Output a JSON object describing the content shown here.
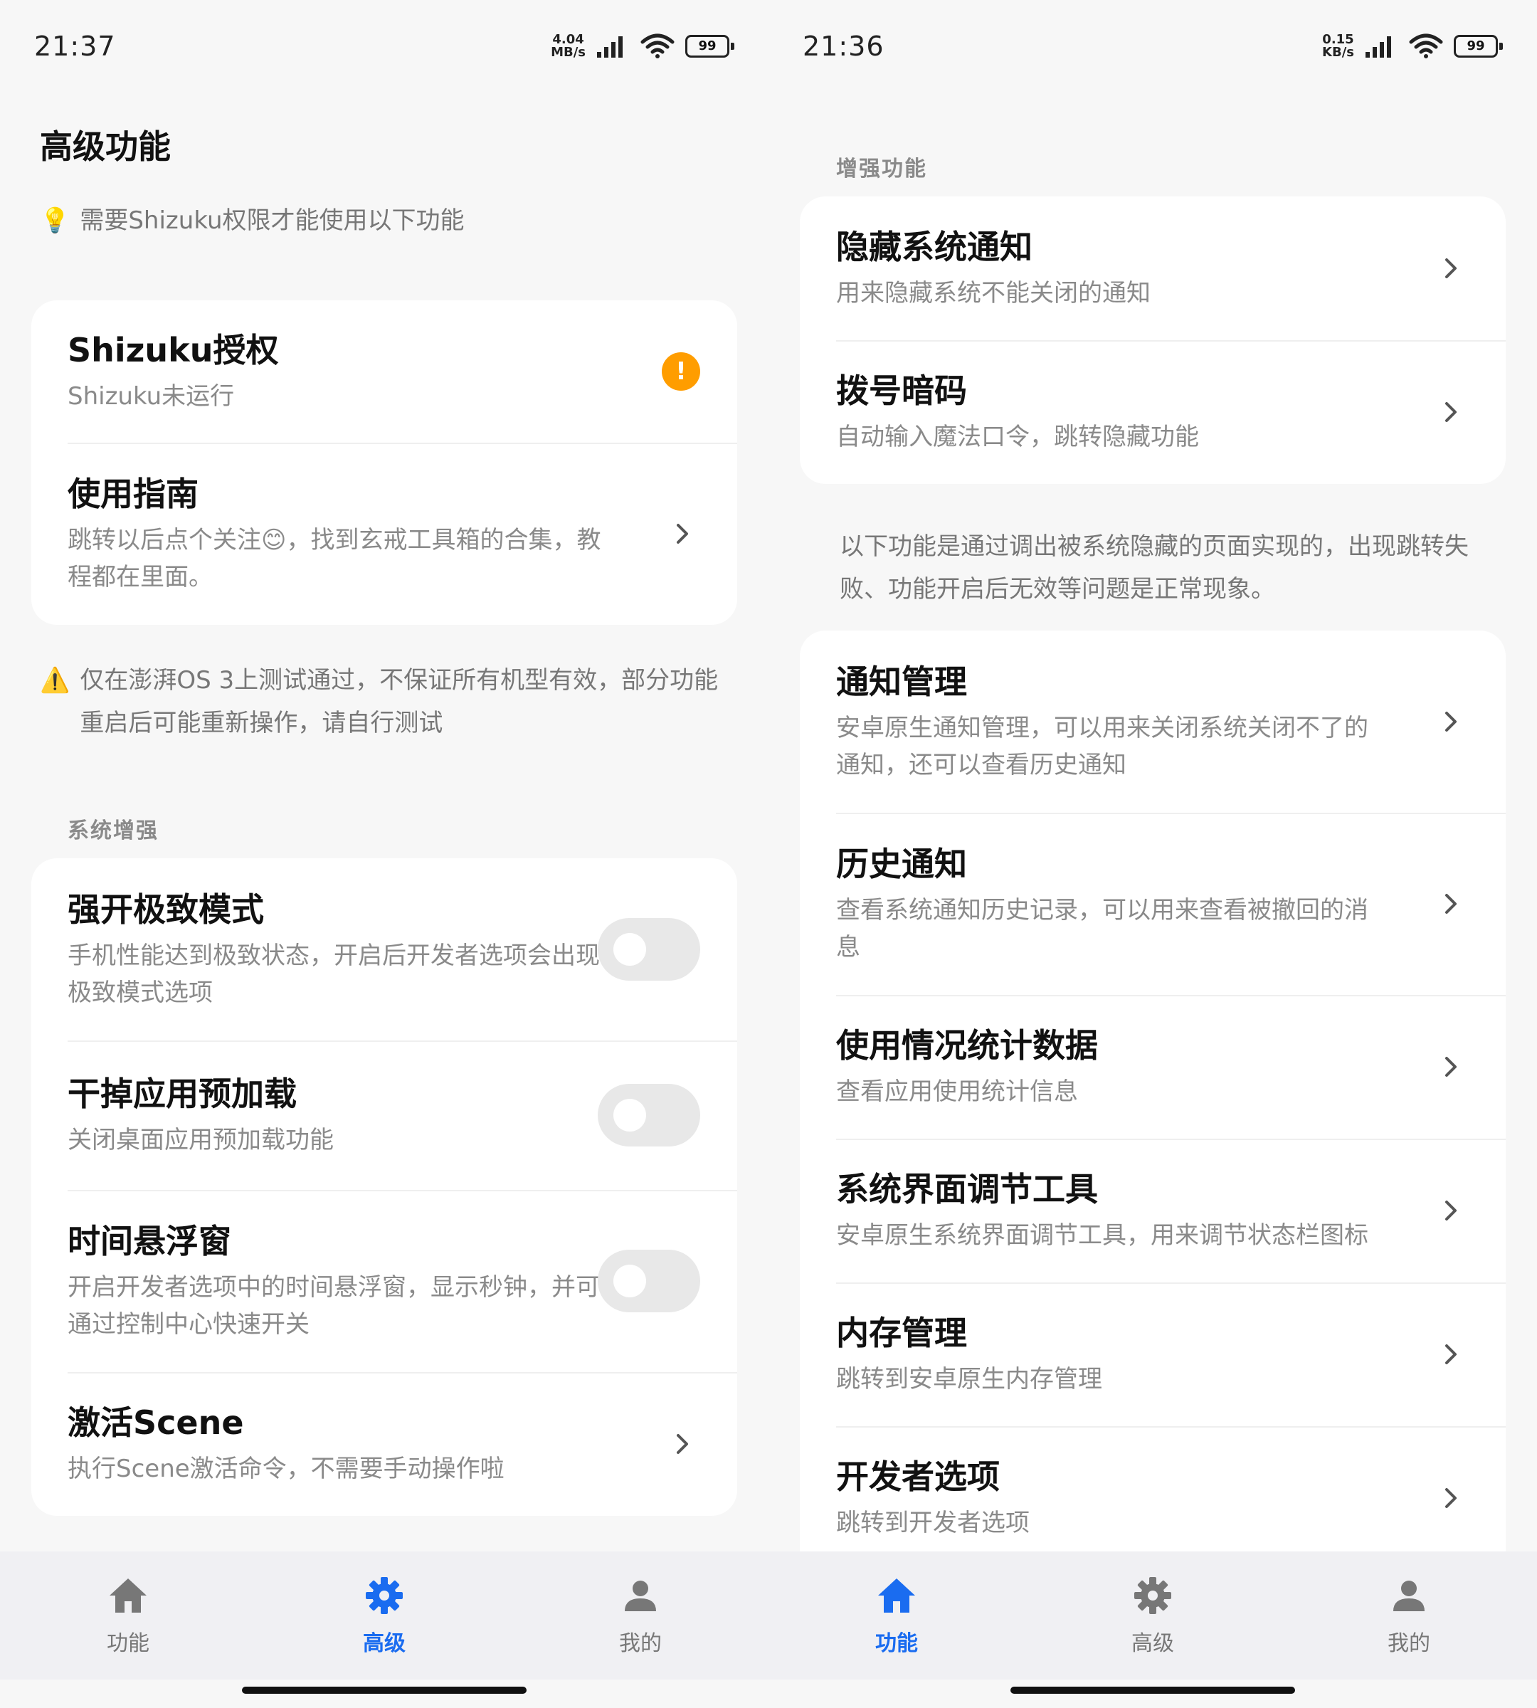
{
  "colors": {
    "accent": "#1a6cf0",
    "warning": "#ff9d00",
    "inactive_icon": "#777777"
  },
  "left": {
    "status": {
      "time": "21:37",
      "speed_value": "4.04",
      "speed_unit": "MB/s",
      "battery": "99"
    },
    "page_title": "高级功能",
    "hint": {
      "icon": "lightbulb-icon",
      "emoji": "💡",
      "text": "需要Shizuku权限才能使用以下功能"
    },
    "auth_card": {
      "shizuku": {
        "title": "Shizuku授权",
        "subtitle": "Shizuku未运行",
        "badge": "!"
      },
      "guide": {
        "title": "使用指南",
        "subtitle": "跳转以后点个关注😊，找到玄戒工具箱的合集，教程都在里面。"
      }
    },
    "warning": {
      "icon": "warning-icon",
      "emoji": "⚠️",
      "text": "仅在澎湃OS 3上测试通过，不保证所有机型有效，部分功能重启后可能重新操作，请自行测试"
    },
    "section_label": "系统增强",
    "system_items": [
      {
        "title": "强开极致模式",
        "subtitle": "手机性能达到极致状态，开启后开发者选项会出现极致模式选项",
        "control": "toggle",
        "on": false
      },
      {
        "title": "干掉应用预加载",
        "subtitle": "关闭桌面应用预加载功能",
        "control": "toggle",
        "on": false
      },
      {
        "title": "时间悬浮窗",
        "subtitle": "开启开发者选项中的时间悬浮窗，显示秒钟，并可通过控制中心快速开关",
        "control": "toggle",
        "on": false
      },
      {
        "title": "激活Scene",
        "subtitle": "执行Scene激活命令，不需要手动操作啦",
        "control": "chevron"
      }
    ],
    "nav": [
      {
        "label": "功能",
        "icon": "home-icon",
        "active": false
      },
      {
        "label": "高级",
        "icon": "gear-icon",
        "active": true
      },
      {
        "label": "我的",
        "icon": "person-icon",
        "active": false
      }
    ]
  },
  "right": {
    "status": {
      "time": "21:36",
      "speed_value": "0.15",
      "speed_unit": "KB/s",
      "battery": "99"
    },
    "section_label": "增强功能",
    "enhance_items": [
      {
        "title": "隐藏系统通知",
        "subtitle": "用来隐藏系统不能关闭的通知"
      },
      {
        "title": "拨号暗码",
        "subtitle": "自动输入魔法口令，跳转隐藏功能"
      }
    ],
    "note": "以下功能是通过调出被系统隐藏的页面实现的，出现跳转失败、功能开启后无效等问题是正常现象。",
    "hidden_items": [
      {
        "title": "通知管理",
        "subtitle": "安卓原生通知管理，可以用来关闭系统关闭不了的通知，还可以查看历史通知"
      },
      {
        "title": "历史通知",
        "subtitle": "查看系统通知历史记录，可以用来查看被撤回的消息"
      },
      {
        "title": "使用情况统计数据",
        "subtitle": "查看应用使用统计信息"
      },
      {
        "title": "系统界面调节工具",
        "subtitle": "安卓原生系统界面调节工具，用来调节状态栏图标"
      },
      {
        "title": "内存管理",
        "subtitle": "跳转到安卓原生内存管理"
      },
      {
        "title": "开发者选项",
        "subtitle": "跳转到开发者选项"
      }
    ],
    "nav": [
      {
        "label": "功能",
        "icon": "home-icon",
        "active": true
      },
      {
        "label": "高级",
        "icon": "gear-icon",
        "active": false
      },
      {
        "label": "我的",
        "icon": "person-icon",
        "active": false
      }
    ]
  }
}
